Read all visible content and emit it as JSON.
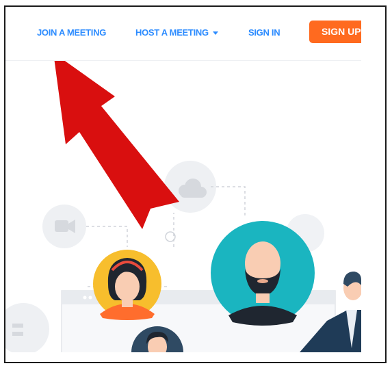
{
  "nav": {
    "join_label": "JOIN A MEETING",
    "host_label": "HOST A MEETING",
    "signin_label": "SIGN IN",
    "signup_label": "SIGN UP"
  },
  "colors": {
    "link": "#2d8cff",
    "signup_bg": "#ff6a1f",
    "annotation_arrow": "#d90f0f"
  },
  "icons": [
    "caret-down-icon",
    "video-camera-icon",
    "cloud-icon",
    "red-arrow-annotation"
  ]
}
